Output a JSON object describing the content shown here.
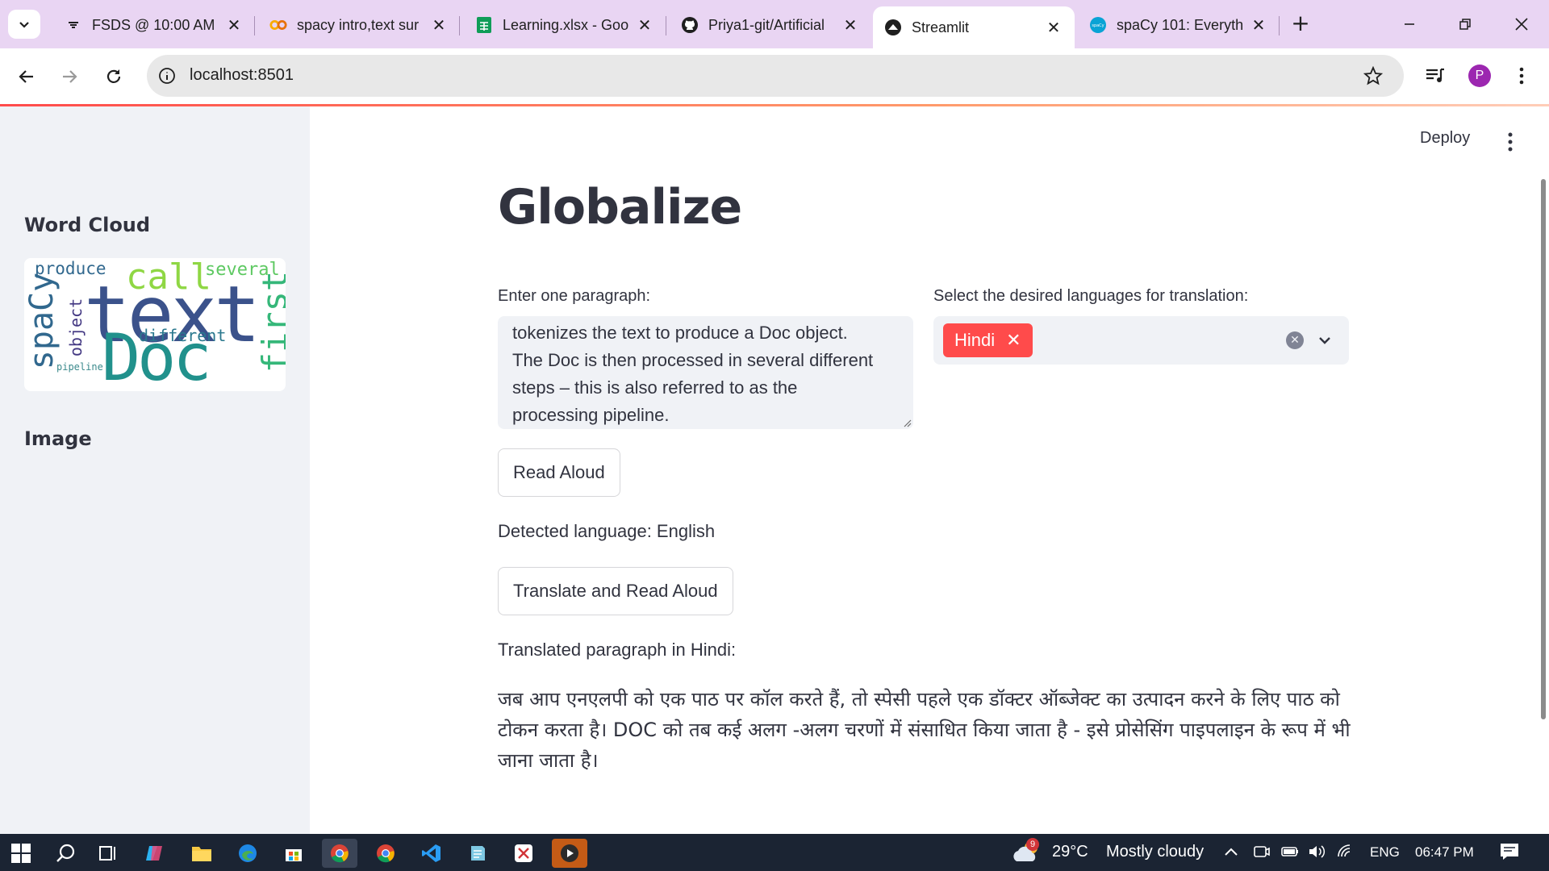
{
  "browser": {
    "tabs": [
      {
        "title": "FSDS @ 10:00 AM",
        "icon": "tab-icon-notification",
        "active": false
      },
      {
        "title": "spacy intro,text sur",
        "icon": "colab-icon",
        "active": false
      },
      {
        "title": "Learning.xlsx - Goo",
        "icon": "sheets-icon",
        "active": false
      },
      {
        "title": "Priya1-git/Artificial",
        "icon": "github-icon",
        "active": false
      },
      {
        "title": "Streamlit",
        "icon": "streamlit-icon",
        "active": true
      },
      {
        "title": "spaCy 101: Everyth",
        "icon": "spacy-icon",
        "active": false
      }
    ],
    "url": "localhost:8501",
    "profile_initial": "P"
  },
  "app": {
    "deploy_label": "Deploy",
    "title": "Globalize",
    "input_label": "Enter one paragraph:",
    "input_text": "tokenizes the text to produce a Doc object.\nThe Doc is then processed in several different\nsteps – this is also referred to as the\nprocessing pipeline.",
    "lang_label": "Select the desired languages for translation:",
    "selected_languages": [
      "Hindi"
    ],
    "read_aloud_label": "Read Aloud",
    "detected_language": "Detected language: English",
    "translate_label": "Translate and Read Aloud",
    "translated_heading": "Translated paragraph in Hindi:",
    "translated_text": "जब आप एनएलपी को एक पाठ पर कॉल करते हैं, तो स्पेसी पहले एक डॉक्टर ऑब्जेक्ट का उत्पादन करने के लिए पाठ को टोकन करता है। DOC को तब कई अलग -अलग चरणों में संसाधित किया जाता है - इसे प्रोसेसिंग पाइपलाइन के रूप में भी जाना जाता है।"
  },
  "sidebar": {
    "wordcloud_heading": "Word Cloud",
    "image_heading": "Image",
    "wordcloud_words": [
      {
        "word": "text",
        "color": "#3b528b"
      },
      {
        "word": "Doc",
        "color": "#21918c"
      },
      {
        "word": "call",
        "color": "#8fd744"
      },
      {
        "word": "spaCy",
        "color": "#31688e"
      },
      {
        "word": "first",
        "color": "#35b779"
      },
      {
        "word": "several",
        "color": "#5ec962"
      },
      {
        "word": "produce",
        "color": "#31688e"
      },
      {
        "word": "different",
        "color": "#2a788e"
      },
      {
        "word": "object",
        "color": "#443983"
      },
      {
        "word": "pipeline",
        "color": "#3b8a8c"
      }
    ]
  },
  "taskbar": {
    "temperature": "29°C",
    "weather": "Mostly cloudy",
    "weather_badge": "9",
    "language": "ENG",
    "time": "06:47 PM"
  },
  "colors": {
    "accent": "#ff4b4b",
    "tabbar": "#e9d5f3",
    "sidebar": "#f0f2f6",
    "taskbar": "#1b2433"
  }
}
